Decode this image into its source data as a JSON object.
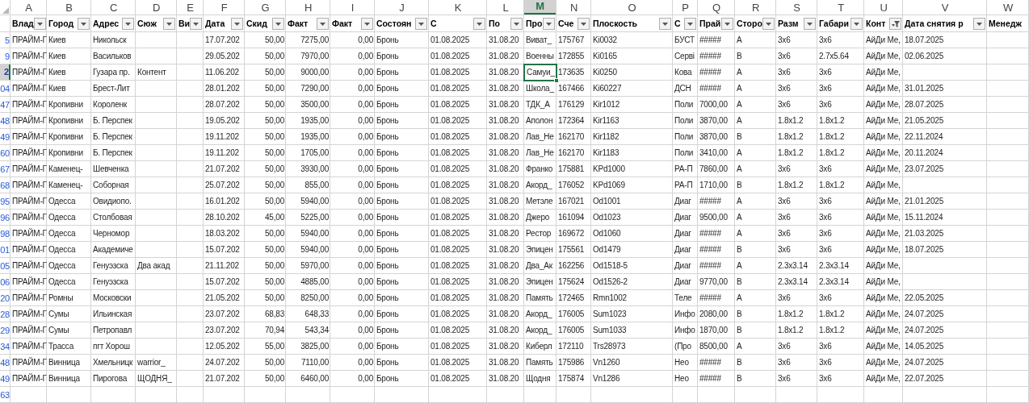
{
  "columns": [
    {
      "letter": "A",
      "header": "Влад",
      "kind": "text",
      "filtered": false,
      "selected": false
    },
    {
      "letter": "B",
      "header": "Город",
      "kind": "text",
      "filtered": false,
      "selected": false
    },
    {
      "letter": "C",
      "header": "Адрес",
      "kind": "text",
      "filtered": false,
      "selected": false
    },
    {
      "letter": "D",
      "header": "Сюж",
      "kind": "text",
      "filtered": false,
      "selected": false
    },
    {
      "letter": "E",
      "header": "Ви",
      "kind": "text",
      "filtered": false,
      "selected": false
    },
    {
      "letter": "F",
      "header": "Дата",
      "kind": "text",
      "filtered": false,
      "selected": false
    },
    {
      "letter": "G",
      "header": "Скид",
      "kind": "number",
      "filtered": false,
      "selected": false
    },
    {
      "letter": "H",
      "header": "Факт",
      "kind": "number",
      "filtered": false,
      "selected": false
    },
    {
      "letter": "I",
      "header": "Факт",
      "kind": "number",
      "filtered": false,
      "selected": false
    },
    {
      "letter": "J",
      "header": "Состоян",
      "kind": "text",
      "filtered": false,
      "selected": false
    },
    {
      "letter": "K",
      "header": "С",
      "kind": "text",
      "filtered": false,
      "selected": false
    },
    {
      "letter": "L",
      "header": "По",
      "kind": "text",
      "filtered": false,
      "selected": false
    },
    {
      "letter": "M",
      "header": "Про",
      "kind": "text",
      "filtered": false,
      "selected": true
    },
    {
      "letter": "N",
      "header": "Сче",
      "kind": "text",
      "filtered": false,
      "selected": false
    },
    {
      "letter": "O",
      "header": "Плоскость",
      "kind": "text",
      "filtered": false,
      "selected": false
    },
    {
      "letter": "P",
      "header": "С",
      "kind": "text",
      "filtered": false,
      "selected": false
    },
    {
      "letter": "Q",
      "header": "Прай",
      "kind": "text",
      "filtered": false,
      "selected": false
    },
    {
      "letter": "R",
      "header": "Сторо",
      "kind": "text",
      "filtered": false,
      "selected": false
    },
    {
      "letter": "S",
      "header": "Разм",
      "kind": "text",
      "filtered": false,
      "selected": false
    },
    {
      "letter": "T",
      "header": "Габари",
      "kind": "text",
      "filtered": false,
      "selected": false
    },
    {
      "letter": "U",
      "header": "Конт",
      "kind": "text",
      "filtered": true,
      "selected": false
    },
    {
      "letter": "V",
      "header": "Дата снятия р",
      "kind": "text",
      "filtered": false,
      "selected": false
    },
    {
      "letter": "W",
      "header": "Менедж",
      "kind": "text",
      "selected": false
    }
  ],
  "rows": [
    {
      "number": "5",
      "selected": false,
      "cells": {
        "A": "ПРАЙМ-Г",
        "B": "Киев",
        "C": "Никольск",
        "F": "17.07.202",
        "G": "50,00",
        "H": "7275,00",
        "I": "0,00",
        "J": "Бронь",
        "K": "01.08.2025",
        "L": "31.08.20",
        "M": "Виват_",
        "N": "175767",
        "O": "Ki0032",
        "P": "БУСТ",
        "Q": "#####",
        "R": "A",
        "S": "3x6",
        "T": "3x6",
        "U": "АйДи Ме,",
        "V": "18.07.2025"
      }
    },
    {
      "number": "9",
      "selected": false,
      "cells": {
        "A": "ПРАЙМ-Г",
        "B": "Киев",
        "C": "Васильков",
        "F": "29.05.202",
        "G": "50,00",
        "H": "7970,00",
        "I": "0,00",
        "J": "Бронь",
        "K": "01.08.2025",
        "L": "31.08.20",
        "M": "Военны",
        "N": "172855",
        "O": "Ki0165",
        "P": "Серві",
        "Q": "#####",
        "R": "B",
        "S": "3x6",
        "T": "2.7x5.64",
        "U": "АйДи Ме,",
        "V": "02.06.2025"
      }
    },
    {
      "number": "2",
      "selected": true,
      "cells": {
        "A": "ПРАЙМ-Г",
        "B": "Киев",
        "C": "Гузара пр.",
        "D": "Контент",
        "F": "11.06.202",
        "G": "50,00",
        "H": "9000,00",
        "I": "0,00",
        "J": "Бронь",
        "K": "01.08.2025",
        "L": "31.08.20",
        "M": "Самуи_",
        "N": "173635",
        "O": "Ki0250",
        "P": "Кова",
        "Q": "#####",
        "R": "A",
        "S": "3x6",
        "T": "3x6",
        "U": "АйДи Ме,"
      }
    },
    {
      "number": "04",
      "selected": false,
      "cells": {
        "A": "ПРАЙМ-Г",
        "B": "Киев",
        "C": "Брест-Лит",
        "F": "28.01.202",
        "G": "50,00",
        "H": "7290,00",
        "I": "0,00",
        "J": "Бронь",
        "K": "01.08.2025",
        "L": "31.08.20",
        "M": "Школа_",
        "N": "167466",
        "O": "Ki60227",
        "P": "ДСН",
        "Q": "#####",
        "R": "A",
        "S": "3x6",
        "T": "3x6",
        "U": "АйДи Ме,",
        "V": "31.01.2025"
      }
    },
    {
      "number": "47",
      "selected": false,
      "cells": {
        "A": "ПРАЙМ-Г",
        "B": "Кропивни",
        "C": "Короленк",
        "F": "28.07.202",
        "G": "50,00",
        "H": "3500,00",
        "I": "0,00",
        "J": "Бронь",
        "K": "01.08.2025",
        "L": "31.08.20",
        "M": "ТДК_А",
        "N": "176129",
        "O": "Kir1012",
        "P": "Поли",
        "Q": "7000,00",
        "R": "A",
        "S": "3x6",
        "T": "3x6",
        "U": "АйДи Ме,",
        "V": "28.07.2025"
      }
    },
    {
      "number": "48",
      "selected": false,
      "cells": {
        "A": "ПРАЙМ-Г",
        "B": "Кропивни",
        "C": "Б. Перспек",
        "F": "19.05.202",
        "G": "50,00",
        "H": "1935,00",
        "I": "0,00",
        "J": "Бронь",
        "K": "01.08.2025",
        "L": "31.08.20",
        "M": "Аполон",
        "N": "172364",
        "O": "Kir1163",
        "P": "Поли",
        "Q": "3870,00",
        "R": "A",
        "S": "1.8x1.2",
        "T": "1.8x1.2",
        "U": "АйДи Ме,",
        "V": "21.05.2025"
      }
    },
    {
      "number": "49",
      "selected": false,
      "cells": {
        "A": "ПРАЙМ-Г",
        "B": "Кропивни",
        "C": "Б. Перспек",
        "F": "19.11.202",
        "G": "50,00",
        "H": "1935,00",
        "I": "0,00",
        "J": "Бронь",
        "K": "01.08.2025",
        "L": "31.08.20",
        "M": "Лав_Не",
        "N": "162170",
        "O": "Kir1182",
        "P": "Поли",
        "Q": "3870,00",
        "R": "B",
        "S": "1.8x1.2",
        "T": "1.8x1.2",
        "U": "АйДи Ме,",
        "V": "22.11.2024"
      }
    },
    {
      "number": "60",
      "selected": false,
      "cells": {
        "A": "ПРАЙМ-Г",
        "B": "Кропивни",
        "C": "Б. Перспек",
        "F": "19.11.202",
        "G": "50,00",
        "H": "1705,00",
        "I": "0,00",
        "J": "Бронь",
        "K": "01.08.2025",
        "L": "31.08.20",
        "M": "Лав_Не",
        "N": "162170",
        "O": "Kir1183",
        "P": "Поли",
        "Q": "3410,00",
        "R": "A",
        "S": "1.8x1.2",
        "T": "1.8x1.2",
        "U": "АйДи Ме,",
        "V": "20.11.2024"
      }
    },
    {
      "number": "67",
      "selected": false,
      "cells": {
        "A": "ПРАЙМ-Г",
        "B": "Каменец-",
        "C": "Шевченка",
        "F": "21.07.202",
        "G": "50,00",
        "H": "3930,00",
        "I": "0,00",
        "J": "Бронь",
        "K": "01.08.2025",
        "L": "31.08.20",
        "M": "Франко",
        "N": "175881",
        "O": "KPd1000",
        "P": "РА-П",
        "Q": "7860,00",
        "R": "A",
        "S": "3x6",
        "T": "3x6",
        "U": "АйДи Ме,",
        "V": "23.07.2025"
      }
    },
    {
      "number": "68",
      "selected": false,
      "cells": {
        "A": "ПРАЙМ-Г",
        "B": "Каменец-",
        "C": "Соборная",
        "F": "25.07.202",
        "G": "50,00",
        "H": "855,00",
        "I": "0,00",
        "J": "Бронь",
        "K": "01.08.2025",
        "L": "31.08.20",
        "M": "Акорд_",
        "N": "176052",
        "O": "KPd1069",
        "P": "РА-П",
        "Q": "1710,00",
        "R": "B",
        "S": "1.8x1.2",
        "T": "1.8x1.2",
        "U": "АйДи Ме,"
      }
    },
    {
      "number": "95",
      "selected": false,
      "cells": {
        "A": "ПРАЙМ-Г",
        "B": "Одесса",
        "C": "Овидиопо.",
        "F": "16.01.202",
        "G": "50,00",
        "H": "5940,00",
        "I": "0,00",
        "J": "Бронь",
        "K": "01.08.2025",
        "L": "31.08.20",
        "M": "Метэле",
        "N": "167021",
        "O": "Od1001",
        "P": "Диаг",
        "Q": "#####",
        "R": "A",
        "S": "3x6",
        "T": "3x6",
        "U": "АйДи Ме,",
        "V": "21.01.2025"
      }
    },
    {
      "number": "96",
      "selected": false,
      "cells": {
        "A": "ПРАЙМ-Г",
        "B": "Одесса",
        "C": "Столбовая",
        "F": "28.10.202",
        "G": "45,00",
        "H": "5225,00",
        "I": "0,00",
        "J": "Бронь",
        "K": "01.08.2025",
        "L": "31.08.20",
        "M": "Джеро",
        "N": "161094",
        "O": "Od1023",
        "P": "Диаг",
        "Q": "9500,00",
        "R": "A",
        "S": "3x6",
        "T": "3x6",
        "U": "АйДи Ме,",
        "V": "15.11.2024"
      }
    },
    {
      "number": "98",
      "selected": false,
      "cells": {
        "A": "ПРАЙМ-Г",
        "B": "Одесса",
        "C": "Черномор",
        "F": "18.03.202",
        "G": "50,00",
        "H": "5940,00",
        "I": "0,00",
        "J": "Бронь",
        "K": "01.08.2025",
        "L": "31.08.20",
        "M": "Рестор",
        "N": "169672",
        "O": "Od1060",
        "P": "Диаг",
        "Q": "#####",
        "R": "A",
        "S": "3x6",
        "T": "3x6",
        "U": "АйДи Ме,",
        "V": "21.03.2025"
      }
    },
    {
      "number": "01",
      "selected": false,
      "cells": {
        "A": "ПРАЙМ-Г",
        "B": "Одесса",
        "C": "Академиче",
        "F": "15.07.202",
        "G": "50,00",
        "H": "5940,00",
        "I": "0,00",
        "J": "Бронь",
        "K": "01.08.2025",
        "L": "31.08.20",
        "M": "Эпицен",
        "N": "175561",
        "O": "Od1479",
        "P": "Диаг",
        "Q": "#####",
        "R": "B",
        "S": "3x6",
        "T": "3x6",
        "U": "АйДи Ме,",
        "V": "18.07.2025"
      }
    },
    {
      "number": "05",
      "selected": false,
      "cells": {
        "A": "ПРАЙМ-Г",
        "B": "Одесса",
        "C": "Генуэзска",
        "D": "Два акад",
        "F": "21.11.202",
        "G": "50,00",
        "H": "5970,00",
        "I": "0,00",
        "J": "Бронь",
        "K": "01.08.2025",
        "L": "31.08.20",
        "M": "Два_Ак",
        "N": "162256",
        "O": "Od1518-5",
        "P": "Диаг",
        "Q": "#####",
        "R": "A",
        "S": "2.3x3.14",
        "T": "2.3x3.14",
        "U": "АйДи Ме,"
      }
    },
    {
      "number": "06",
      "selected": false,
      "cells": {
        "A": "ПРАЙМ-Г",
        "B": "Одесса",
        "C": "Генуэзска",
        "F": "15.07.202",
        "G": "50,00",
        "H": "4885,00",
        "I": "0,00",
        "J": "Бронь",
        "K": "01.08.2025",
        "L": "31.08.20",
        "M": "Эпицен",
        "N": "175624",
        "O": "Od1526-2",
        "P": "Диаг",
        "Q": "9770,00",
        "R": "B",
        "S": "2.3x3.14",
        "T": "2.3x3.14",
        "U": "АйДи Ме,"
      }
    },
    {
      "number": "20",
      "selected": false,
      "cells": {
        "A": "ПРАЙМ-Г",
        "B": "Ромны",
        "C": "Московски",
        "F": "21.05.202",
        "G": "50,00",
        "H": "8250,00",
        "I": "0,00",
        "J": "Бронь",
        "K": "01.08.2025",
        "L": "31.08.20",
        "M": "Память",
        "N": "172465",
        "O": "Rmn1002",
        "P": "Теле",
        "Q": "#####",
        "R": "A",
        "S": "3x6",
        "T": "3x6",
        "U": "АйДи Ме,",
        "V": "22.05.2025"
      }
    },
    {
      "number": "28",
      "selected": false,
      "cells": {
        "A": "ПРАЙМ-Г",
        "B": "Сумы",
        "C": "Ильинская",
        "F": "23.07.202",
        "G": "68,83",
        "H": "648,33",
        "I": "0,00",
        "J": "Бронь",
        "K": "01.08.2025",
        "L": "31.08.20",
        "M": "Акорд_",
        "N": "176005",
        "O": "Sum1023",
        "P": "Инфо",
        "Q": "2080,00",
        "R": "B",
        "S": "1.8x1.2",
        "T": "1.8x1.2",
        "U": "АйДи Ме,",
        "V": "24.07.2025"
      }
    },
    {
      "number": "29",
      "selected": false,
      "cells": {
        "A": "ПРАЙМ-Г",
        "B": "Сумы",
        "C": "Петропавл",
        "F": "23.07.202",
        "G": "70,94",
        "H": "543,34",
        "I": "0,00",
        "J": "Бронь",
        "K": "01.08.2025",
        "L": "31.08.20",
        "M": "Акорд_",
        "N": "176005",
        "O": "Sum1033",
        "P": "Инфо",
        "Q": "1870,00",
        "R": "B",
        "S": "1.8x1.2",
        "T": "1.8x1.2",
        "U": "АйДи Ме,",
        "V": "24.07.2025"
      }
    },
    {
      "number": "34",
      "selected": false,
      "cells": {
        "A": "ПРАЙМ-Г",
        "B": "Трасса",
        "C": "пгт Хорош",
        "F": "12.05.202",
        "G": "55,00",
        "H": "3825,00",
        "I": "0,00",
        "J": "Бронь",
        "K": "01.08.2025",
        "L": "31.08.20",
        "M": "Киберл",
        "N": "172110",
        "O": "Trs28973",
        "P": "(Про",
        "Q": "8500,00",
        "R": "A",
        "S": "3x6",
        "T": "3x6",
        "U": "АйДи Ме,",
        "V": "14.05.2025"
      }
    },
    {
      "number": "48",
      "selected": false,
      "cells": {
        "A": "ПРАЙМ-Г",
        "B": "Винница",
        "C": "Хмельницк",
        "D": "warrior_",
        "F": "24.07.202",
        "G": "50,00",
        "H": "7110,00",
        "I": "0,00",
        "J": "Бронь",
        "K": "01.08.2025",
        "L": "31.08.20",
        "M": "Память",
        "N": "175986",
        "O": "Vn1260",
        "P": "Нео",
        "Q": "#####",
        "R": "B",
        "S": "3x6",
        "T": "3x6",
        "U": "АйДи Ме,",
        "V": "24.07.2025"
      }
    },
    {
      "number": "49",
      "selected": false,
      "cells": {
        "A": "ПРАЙМ-Г",
        "B": "Винница",
        "C": "Пирогова",
        "D": "ЩОДНЯ_",
        "F": "21.07.202",
        "G": "50,00",
        "H": "6460,00",
        "I": "0,00",
        "J": "Бронь",
        "K": "01.08.2025",
        "L": "31.08.20",
        "M": "Щодня",
        "N": "175874",
        "O": "Vn1286",
        "P": "Нео",
        "Q": "#####",
        "R": "B",
        "S": "3x6",
        "T": "3x6",
        "U": "АйДи Ме,",
        "V": "22.07.2025"
      }
    },
    {
      "number": "63",
      "selected": false,
      "cells": {}
    }
  ]
}
